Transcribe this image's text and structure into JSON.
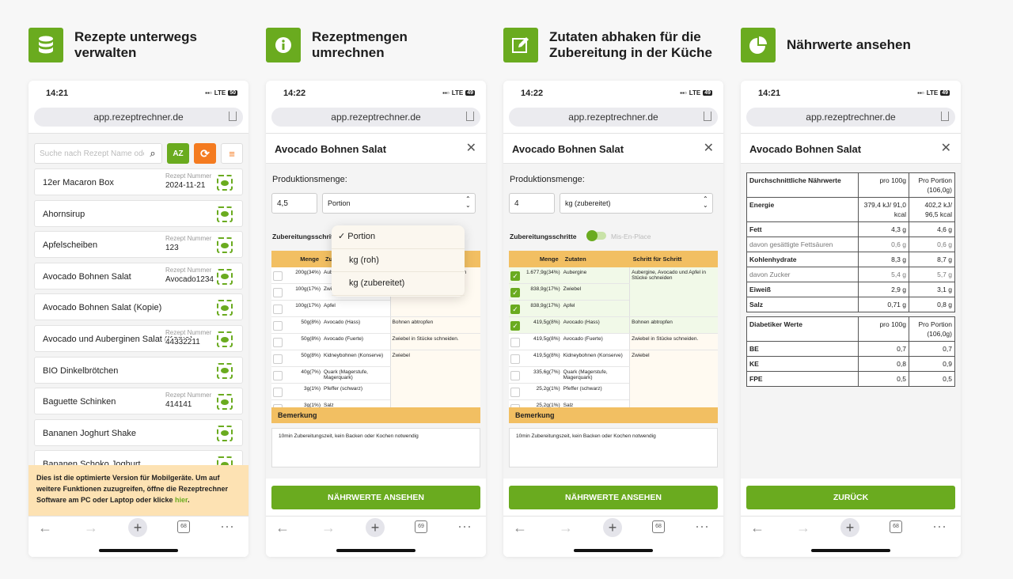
{
  "colors": {
    "brand_green": "#6aab1f",
    "accent_orange": "#f47b20",
    "table_header": "#f2bf62",
    "banner": "#fde2b3"
  },
  "features": [
    {
      "icon": "database-icon",
      "title": "Rezepte unterwegs verwalten"
    },
    {
      "icon": "info-icon",
      "title": "Rezeptmengen umrechnen"
    },
    {
      "icon": "edit-icon",
      "title": "Zutaten abhaken für die Zubereitung in der Küche"
    },
    {
      "icon": "pie-chart-icon",
      "title": "Nährwerte ansehen"
    }
  ],
  "phones": [
    {
      "time": "14:21",
      "network": "LTE",
      "battery": "50",
      "url": "app.rezeptrechner.de",
      "tabs": "68"
    },
    {
      "time": "14:22",
      "network": "LTE",
      "battery": "49",
      "url": "app.rezeptrechner.de",
      "tabs": "69"
    },
    {
      "time": "14:22",
      "network": "LTE",
      "battery": "49",
      "url": "app.rezeptrechner.de",
      "tabs": "68"
    },
    {
      "time": "14:21",
      "network": "LTE",
      "battery": "49",
      "url": "app.rezeptrechner.de",
      "tabs": "68"
    }
  ],
  "list": {
    "search_placeholder": "Suche nach Rezept Name oder Nummer",
    "sort_label": "AZ",
    "number_label": "Rezept Nummer",
    "items": [
      {
        "name": "12er Macaron Box",
        "number": "2024-11-21"
      },
      {
        "name": "Ahornsirup",
        "number": ""
      },
      {
        "name": "Apfelscheiben",
        "number": "123"
      },
      {
        "name": "Avocado Bohnen Salat",
        "number": "Avocado1234"
      },
      {
        "name": "Avocado Bohnen Salat (Kopie)",
        "number": ""
      },
      {
        "name": "Avocado und Auberginen Salat (Kopie)",
        "number": "44332211"
      },
      {
        "name": "BIO Dinkelbrötchen",
        "number": ""
      },
      {
        "name": "Baguette Schinken",
        "number": "414141"
      },
      {
        "name": "Bananen Joghurt Shake",
        "number": ""
      },
      {
        "name": "Bananen Schoko Joghurt",
        "number": ""
      }
    ],
    "banner_text": "Dies ist die optimierte Version für Mobilgeräte. Um auf weitere Funktionen zuzugreifen, öffne die Rezeptrechner Software am PC oder Laptop oder klicke ",
    "banner_link": "hier",
    "banner_end": "."
  },
  "recipe": {
    "title": "Avocado Bohnen Salat",
    "production_label": "Produktionsmenge:",
    "steps_label": "Zubereitungsschritte",
    "mise_label": "Mis-En-Place",
    "headers": [
      "Menge",
      "Zutaten",
      "Schritt für Schritt"
    ],
    "remark_label": "Bemerkung",
    "remark": "10min Zubereitungszeit, kein Backen oder Kochen notwendig",
    "button": "NÄHRWERTE ANSEHEN",
    "steps": [
      {
        "text": "Aubergine, Avocado und Apfel in Stücke schneiden",
        "rows": 3
      },
      {
        "text": "Bohnen abtropfen",
        "rows": 1
      },
      {
        "text": "Zwiebel in Stücke schneiden.",
        "rows": 1
      },
      {
        "text": "Zwiebel",
        "rows": 4
      }
    ],
    "ingredients": [
      "Aubergine",
      "Zwiebel",
      "Apfel",
      "Avocado (Hass)",
      "Avocado (Fuerte)",
      "Kidneybohnen (Konserve)",
      "Quark (Magerstufe, Magerquark)",
      "Pfeffer (schwarz)",
      "Salz"
    ],
    "convert": {
      "quantity": "4,5",
      "unit": "Portion",
      "unit_options": [
        "Portion",
        "kg (roh)",
        "kg (zubereitet)"
      ],
      "amounts": [
        "200g(34%)",
        "100g(17%)",
        "100g(17%)",
        "50g(8%)",
        "50g(8%)",
        "50g(8%)",
        "40g(7%)",
        "3g(1%)",
        "3g(1%)"
      ]
    },
    "check": {
      "quantity": "4",
      "unit": "kg (zubereitet)",
      "toggle_on": true,
      "amounts": [
        "1.677,9g(34%)",
        "838,9g(17%)",
        "838,9g(17%)",
        "419,5g(8%)",
        "419,5g(8%)",
        "419,5g(8%)",
        "335,6g(7%)",
        "25,2g(1%)",
        "25,2g(1%)"
      ],
      "checked": [
        true,
        true,
        true,
        true,
        false,
        false,
        false,
        false,
        false
      ]
    }
  },
  "nutrition": {
    "title": "Avocado Bohnen Salat",
    "table1": {
      "header": [
        "Durchschnittliche Nährwerte",
        "pro 100g",
        "Pro Portion (106,0g)"
      ],
      "rows": [
        {
          "label": "Energie",
          "per100": "379,4 kJ/ 91,0 kcal",
          "portion": "402,2 kJ/ 96,5 kcal",
          "sub": false
        },
        {
          "label": "Fett",
          "per100": "4,3 g",
          "portion": "4,6 g",
          "sub": false
        },
        {
          "label": "davon gesättigte Fettsäuren",
          "per100": "0,6 g",
          "portion": "0,6 g",
          "sub": true
        },
        {
          "label": "Kohlenhydrate",
          "per100": "8,3 g",
          "portion": "8,7 g",
          "sub": false
        },
        {
          "label": "davon Zucker",
          "per100": "5,4 g",
          "portion": "5,7 g",
          "sub": true
        },
        {
          "label": "Eiweiß",
          "per100": "2,9 g",
          "portion": "3,1 g",
          "sub": false
        },
        {
          "label": "Salz",
          "per100": "0,71 g",
          "portion": "0,8 g",
          "sub": false
        }
      ]
    },
    "table2": {
      "header": [
        "Diabetiker Werte",
        "pro 100g",
        "Pro Portion (106,0g)"
      ],
      "rows": [
        {
          "label": "BE",
          "per100": "0,7",
          "portion": "0,7",
          "sub": false
        },
        {
          "label": "KE",
          "per100": "0,8",
          "portion": "0,9",
          "sub": false
        },
        {
          "label": "FPE",
          "per100": "0,5",
          "portion": "0,5",
          "sub": false
        }
      ]
    },
    "button": "ZURÜCK"
  }
}
